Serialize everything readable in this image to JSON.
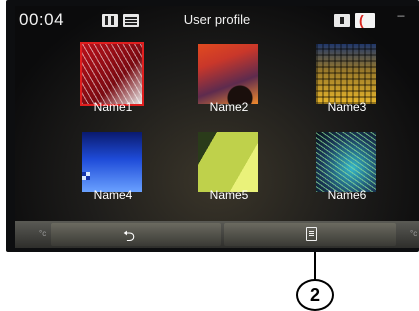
{
  "status": {
    "time": "00:04",
    "title": "User profile",
    "signal_text": "---"
  },
  "profiles": [
    {
      "label": "Name1",
      "selected": true
    },
    {
      "label": "Name2",
      "selected": false
    },
    {
      "label": "Name3",
      "selected": false
    },
    {
      "label": "Name4",
      "selected": false
    },
    {
      "label": "Name5",
      "selected": false
    },
    {
      "label": "Name6",
      "selected": false
    }
  ],
  "bottom_bar": {
    "unit_left": "°c",
    "unit_right": "°c",
    "back_icon": "return-arrow-icon",
    "menu_icon": "list-menu-icon"
  },
  "callout": {
    "number": "2"
  },
  "colors": {
    "accent_red": "#e01f1f",
    "background": "#0b0b0c"
  }
}
